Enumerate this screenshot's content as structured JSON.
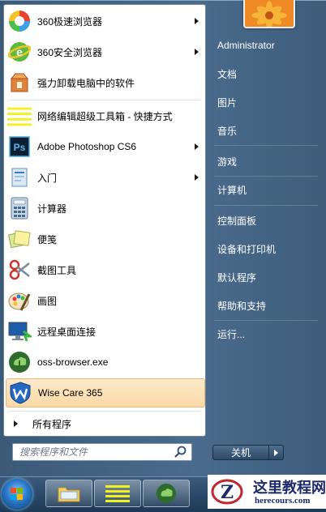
{
  "programs": [
    {
      "label": "360极速浏览器",
      "icon": "360-speed-browser-icon",
      "arrow": true
    },
    {
      "label": "360安全浏览器",
      "icon": "360-safe-browser-icon",
      "arrow": true
    },
    {
      "label": "强力卸载电脑中的软件",
      "icon": "uninstall-box-icon",
      "arrow": false
    },
    {
      "label": "网络编辑超级工具箱 - 快捷方式",
      "icon": "toolbox-shortcut-icon",
      "arrow": false
    },
    {
      "label": "Adobe Photoshop CS6",
      "icon": "photoshop-icon",
      "arrow": true
    },
    {
      "label": "入门",
      "icon": "getting-started-icon",
      "arrow": true
    },
    {
      "label": "计算器",
      "icon": "calculator-icon",
      "arrow": false
    },
    {
      "label": "便笺",
      "icon": "sticky-notes-icon",
      "arrow": false
    },
    {
      "label": "截图工具",
      "icon": "snipping-tool-icon",
      "arrow": false
    },
    {
      "label": "画图",
      "icon": "paint-icon",
      "arrow": false
    },
    {
      "label": "远程桌面连接",
      "icon": "remote-desktop-icon",
      "arrow": false
    },
    {
      "label": "oss-browser.exe",
      "icon": "oss-browser-icon",
      "arrow": false
    },
    {
      "label": "Wise Care 365",
      "icon": "wise-care-icon",
      "arrow": false,
      "highlighted": true
    }
  ],
  "all_programs_label": "所有程序",
  "search": {
    "placeholder": "搜索程序和文件"
  },
  "right_links": [
    {
      "label": "Administrator"
    },
    {
      "label": "文档"
    },
    {
      "label": "图片"
    },
    {
      "label": "音乐"
    },
    {
      "label": "游戏"
    },
    {
      "label": "计算机"
    },
    {
      "label": "控制面板"
    },
    {
      "label": "设备和打印机"
    },
    {
      "label": "默认程序"
    },
    {
      "label": "帮助和支持"
    },
    {
      "label": "运行..."
    }
  ],
  "shutdown_label": "关机",
  "watermark": {
    "title": "这里教程网",
    "url": "herecours.com"
  },
  "colors": {
    "highlight": "#fbd9a7",
    "menu_bg": "#4a6b8c",
    "taskbar": "#1f3b57"
  }
}
